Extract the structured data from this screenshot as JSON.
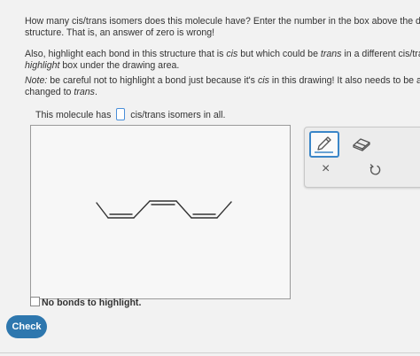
{
  "question": {
    "p1_line1": "How many cis/trans isomers does this molecule have? Enter the number in the box above the dra",
    "p1_line2": "structure. That is, an answer of zero is wrong!",
    "p2_line1_a": "Also, highlight each bond in this structure that is ",
    "p2_line1_cis": "cis",
    "p2_line1_b": " but which could be ",
    "p2_line1_trans": "trans",
    "p2_line1_c": " in a different cis/tra",
    "p2_line2_a": "highlight",
    "p2_line2_b": " box under the drawing area.",
    "note_label": "Note:",
    "note_line1_a": " be careful not to highlight a bond just because it's ",
    "note_line1_cis": "cis",
    "note_line1_b": " in this drawing! It also needs to be a",
    "note_line2_a": "changed to ",
    "note_line2_trans": "trans",
    "note_line2_b": "."
  },
  "answer": {
    "prefix": "This molecule has",
    "suffix": "cis/trans isomers in all.",
    "value": ""
  },
  "no_bonds_label": "No bonds to highlight.",
  "check_label": "Check",
  "tools": {
    "pencil": "pencil-icon",
    "eraser": "eraser-icon",
    "undo": "×",
    "reset": "reset-icon"
  },
  "colors": {
    "accent": "#3a86c8",
    "check_button": "#2e77ae"
  }
}
